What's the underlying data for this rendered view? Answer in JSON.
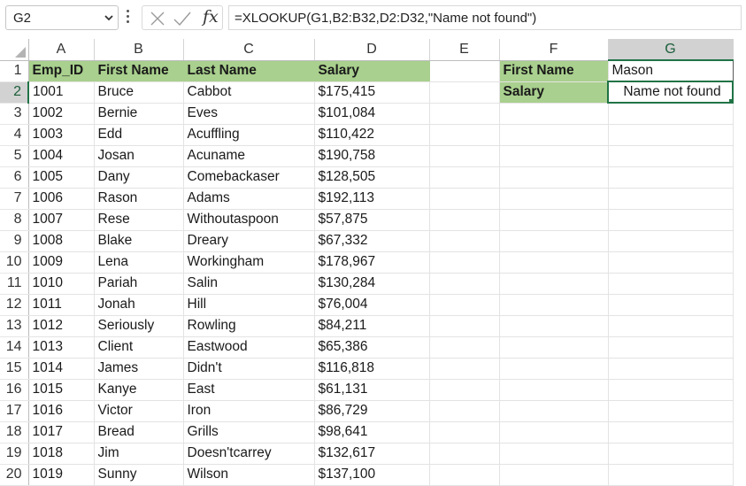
{
  "name_box": {
    "value": "G2"
  },
  "formula_bar": {
    "fx_label": "fx",
    "formula": "=XLOOKUP(G1,B2:B32,D2:D32,\"Name not found\")"
  },
  "columns": [
    "A",
    "B",
    "C",
    "D",
    "E",
    "F",
    "G"
  ],
  "selected_cell": {
    "column": "G",
    "row": "2"
  },
  "header_row": {
    "emp_id": "Emp_ID",
    "first_name": "First Name",
    "last_name": "Last Name",
    "salary": "Salary"
  },
  "rows": [
    {
      "row": "2",
      "emp_id": "1001",
      "first": "Bruce",
      "last": "Cabbot",
      "salary": "$175,415"
    },
    {
      "row": "3",
      "emp_id": "1002",
      "first": "Bernie",
      "last": "Eves",
      "salary": "$101,084"
    },
    {
      "row": "4",
      "emp_id": "1003",
      "first": "Edd",
      "last": "Acuffling",
      "salary": "$110,422"
    },
    {
      "row": "5",
      "emp_id": "1004",
      "first": "Josan",
      "last": "Acuname",
      "salary": "$190,758"
    },
    {
      "row": "6",
      "emp_id": "1005",
      "first": "Dany",
      "last": "Comebackaser",
      "salary": "$128,505"
    },
    {
      "row": "7",
      "emp_id": "1006",
      "first": "Rason",
      "last": "Adams",
      "salary": "$192,113"
    },
    {
      "row": "8",
      "emp_id": "1007",
      "first": "Rese",
      "last": "Withoutaspoon",
      "salary": "$57,875"
    },
    {
      "row": "9",
      "emp_id": "1008",
      "first": "Blake",
      "last": "Dreary",
      "salary": "$67,332"
    },
    {
      "row": "10",
      "emp_id": "1009",
      "first": "Lena",
      "last": "Workingham",
      "salary": "$178,967"
    },
    {
      "row": "11",
      "emp_id": "1010",
      "first": "Pariah",
      "last": "Salin",
      "salary": "$130,284"
    },
    {
      "row": "12",
      "emp_id": "1011",
      "first": "Jonah",
      "last": "Hill",
      "salary": "$76,004"
    },
    {
      "row": "13",
      "emp_id": "1012",
      "first": "Seriously",
      "last": "Rowling",
      "salary": "$84,211"
    },
    {
      "row": "14",
      "emp_id": "1013",
      "first": "Client",
      "last": "Eastwood",
      "salary": "$65,386"
    },
    {
      "row": "15",
      "emp_id": "1014",
      "first": "James",
      "last": "Didn't",
      "salary": "$116,818"
    },
    {
      "row": "16",
      "emp_id": "1015",
      "first": "Kanye",
      "last": "East",
      "salary": "$61,131"
    },
    {
      "row": "17",
      "emp_id": "1016",
      "first": "Victor",
      "last": "Iron",
      "salary": "$86,729"
    },
    {
      "row": "18",
      "emp_id": "1017",
      "first": "Bread",
      "last": "Grills",
      "salary": "$98,641"
    },
    {
      "row": "19",
      "emp_id": "1018",
      "first": "Jim",
      "last": "Doesn'tcarrey",
      "salary": "$132,617"
    },
    {
      "row": "20",
      "emp_id": "1019",
      "first": "Sunny",
      "last": "Wilson",
      "salary": "$137,100"
    }
  ],
  "lookup": {
    "first_name_label": "First Name",
    "first_name_value": "Mason",
    "salary_label": "Salary",
    "salary_result": "Name not found"
  },
  "colors": {
    "header_fill": "#a9d08e",
    "selection": "#217346"
  }
}
